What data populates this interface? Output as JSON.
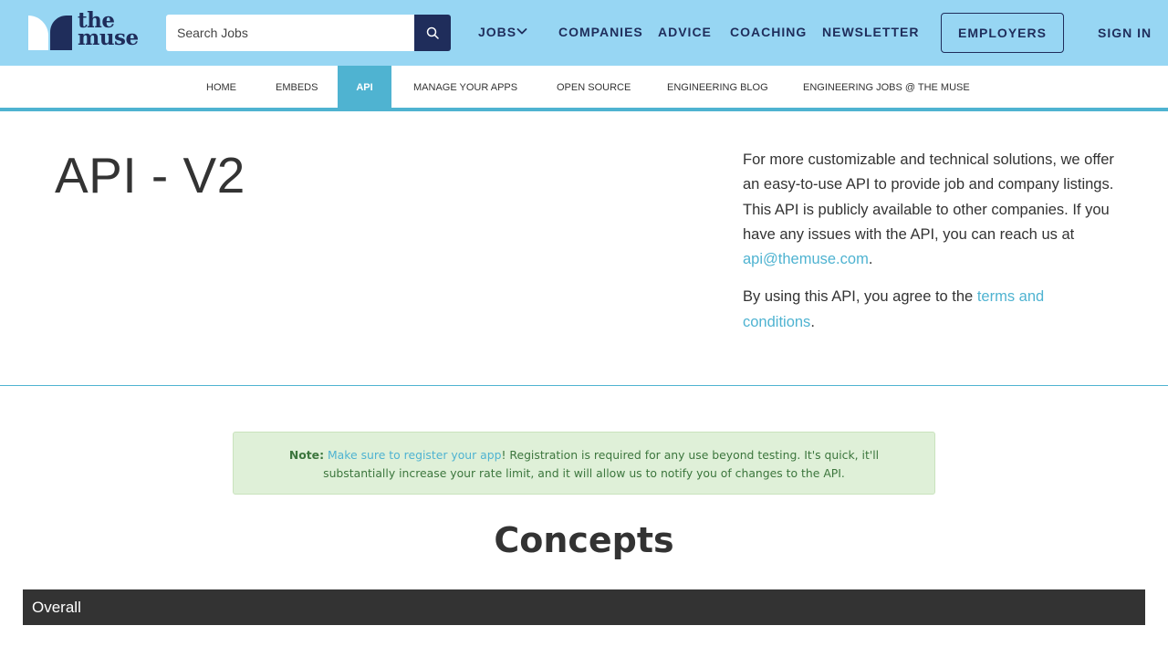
{
  "header": {
    "logo_lines": [
      "the",
      "muse"
    ],
    "search_placeholder": "Search Jobs",
    "nav": {
      "jobs": "JOBS",
      "companies": "COMPANIES",
      "advice": "ADVICE",
      "coaching": "COACHING",
      "newsletter": "NEWSLETTER"
    },
    "employers": "EMPLOYERS",
    "sign_in": "SIGN IN"
  },
  "subnav": {
    "items": [
      "HOME",
      "EMBEDS",
      "API",
      "MANAGE YOUR APPS",
      "OPEN SOURCE",
      "ENGINEERING BLOG",
      "ENGINEERING JOBS @ THE MUSE"
    ],
    "active": "API"
  },
  "hero": {
    "title": "API - V2",
    "para1_text": "For more customizable and technical solutions, we offer an easy-to-use API to provide job and company listings. This API is publicly available to other companies. If you have any issues with the API, you can reach us at ",
    "para1_link": "api@themuse.com",
    "para1_end": ".",
    "para2_text": "By using this API, you agree to the ",
    "para2_link": "terms and conditions",
    "para2_end": "."
  },
  "note": {
    "label": "Note:",
    "link": "Make sure to register your app",
    "text": "! Registration is required for any use beyond testing. It's quick, it'll substantially increase your rate limit, and it will allow us to notify you of changes to the API."
  },
  "concepts": {
    "heading": "Concepts",
    "section": "Overall"
  },
  "colors": {
    "header_bg": "#97d6f3",
    "brand_navy": "#1f2d5b",
    "accent": "#4fb3d1",
    "note_bg": "#dff0d8",
    "note_text": "#3c763d",
    "section_bar": "#333333"
  },
  "icons": {
    "search": "search-icon",
    "jobs_dropdown": "chevron-down-icon"
  }
}
